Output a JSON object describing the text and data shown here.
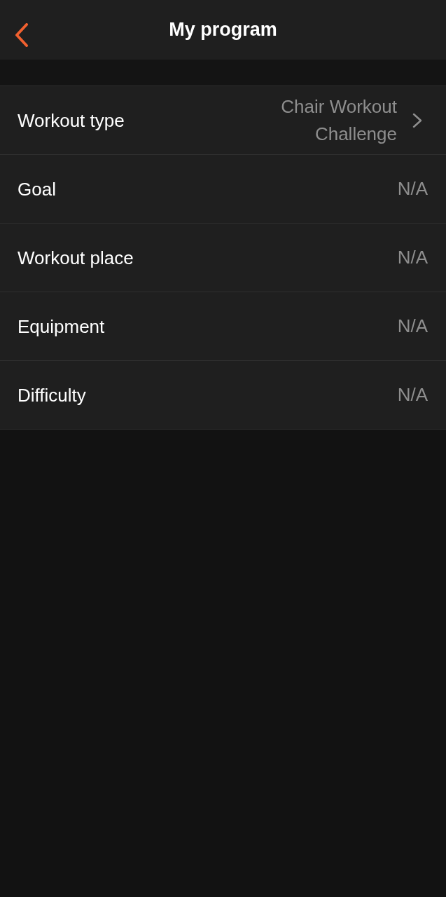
{
  "header": {
    "title": "My program"
  },
  "rows": [
    {
      "kind": "link",
      "label": "Workout type",
      "value": "Chair Workout Challenge"
    },
    {
      "kind": "plain",
      "label": "Goal",
      "value": "N/A"
    },
    {
      "kind": "plain",
      "label": "Workout place",
      "value": "N/A"
    },
    {
      "kind": "plain",
      "label": "Equipment",
      "value": "N/A"
    },
    {
      "kind": "plain",
      "label": "Difficulty",
      "value": "N/A"
    }
  ]
}
